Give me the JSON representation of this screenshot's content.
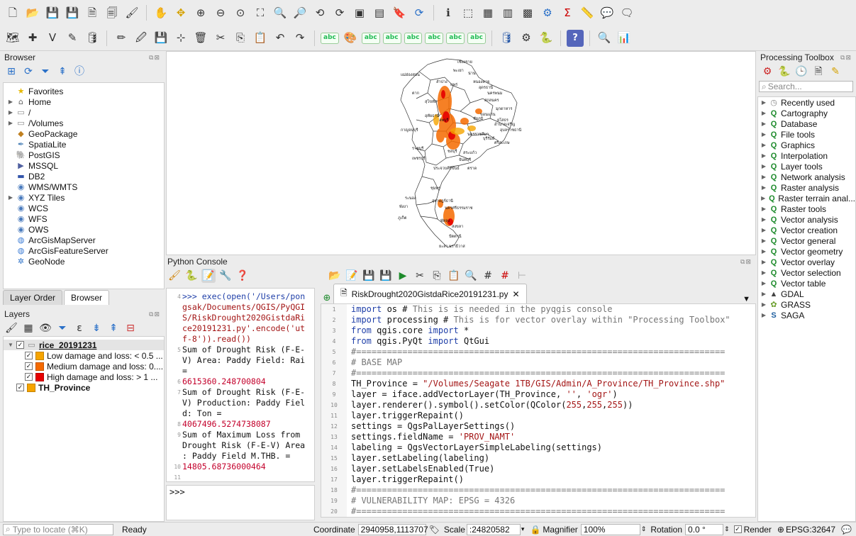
{
  "browser": {
    "title": "Browser",
    "items": [
      {
        "label": "Favorites",
        "icon": "star-icon",
        "caret": false
      },
      {
        "label": "Home",
        "icon": "home-folder-icon",
        "caret": true
      },
      {
        "label": "/",
        "icon": "folder-icon",
        "caret": true
      },
      {
        "label": "/Volumes",
        "icon": "folder-icon",
        "caret": true
      },
      {
        "label": "GeoPackage",
        "icon": "geopackage-icon",
        "caret": false
      },
      {
        "label": "SpatiaLite",
        "icon": "feather-icon",
        "caret": false
      },
      {
        "label": "PostGIS",
        "icon": "elephant-icon",
        "caret": false
      },
      {
        "label": "MSSQL",
        "icon": "mssql-icon",
        "caret": false
      },
      {
        "label": "DB2",
        "icon": "db2-icon",
        "caret": false
      },
      {
        "label": "WMS/WMTS",
        "icon": "globe-icon",
        "caret": false
      },
      {
        "label": "XYZ Tiles",
        "icon": "globe-icon",
        "caret": true
      },
      {
        "label": "WCS",
        "icon": "globe-icon",
        "caret": false
      },
      {
        "label": "WFS",
        "icon": "globe-icon",
        "caret": false
      },
      {
        "label": "OWS",
        "icon": "globe-icon",
        "caret": false
      },
      {
        "label": "ArcGisMapServer",
        "icon": "arcgis-icon",
        "caret": false
      },
      {
        "label": "ArcGisFeatureServer",
        "icon": "arcgis-icon",
        "caret": false
      },
      {
        "label": "GeoNode",
        "icon": "geonode-icon",
        "caret": false
      }
    ]
  },
  "layers_tabs": [
    "Layer Order",
    "Browser"
  ],
  "layers": {
    "title": "Layers",
    "group": "rice_20191231",
    "items": [
      {
        "label": "Low damage and loss: < 0.5 ...",
        "color": "#f6a400"
      },
      {
        "label": "Medium damage and loss: 0....",
        "color": "#f56a00"
      },
      {
        "label": "High damage and loss: > 1 ...",
        "color": "#e60000"
      }
    ],
    "province": {
      "label": "TH_Province",
      "color": "#f6a400"
    }
  },
  "python_console": {
    "title": "Python Console",
    "prompt": ">>>",
    "output": [
      {
        "n": "4",
        "text": ">>> exec(open('/Users/pon",
        "type": "cmd"
      },
      {
        "n": "",
        "text": "gsak/Documents/QGIS/PyQGI",
        "type": "cmd"
      },
      {
        "n": "",
        "text": "S/RiskDrought2020GistdaRi",
        "type": "cmd"
      },
      {
        "n": "",
        "text": "ce20191231.py'.encode('ut",
        "type": "cmd"
      },
      {
        "n": "",
        "text": "f-8')).read())",
        "type": "cmd"
      },
      {
        "n": "5",
        "text": "Sum of Drought Risk (F-E-",
        "type": "text"
      },
      {
        "n": "",
        "text": "V) Area: Paddy Field: Rai",
        "type": "text"
      },
      {
        "n": "",
        "text": " =",
        "type": "text"
      },
      {
        "n": "6",
        "text": "6615360.248700804",
        "type": "num"
      },
      {
        "n": "7",
        "text": "Sum of Drought Risk (F-E-",
        "type": "text"
      },
      {
        "n": "",
        "text": "V) Production: Paddy Fiel",
        "type": "text"
      },
      {
        "n": "",
        "text": "d: Ton =",
        "type": "text"
      },
      {
        "n": "8",
        "text": "4067496.5274738087",
        "type": "num"
      },
      {
        "n": "9",
        "text": "Sum of Maximum Loss from",
        "type": "text"
      },
      {
        "n": "",
        "text": "Drought Risk (F-E-V) Area",
        "type": "text"
      },
      {
        "n": "",
        "text": ": Paddy Field M.THB. =",
        "type": "text"
      },
      {
        "n": "10",
        "text": "14805.68736000464",
        "type": "num"
      },
      {
        "n": "11",
        "text": "",
        "type": "text"
      }
    ]
  },
  "editor": {
    "tab_label": "RiskDrought2020GistdaRice20191231.py",
    "lines": [
      {
        "n": "1",
        "html": "<span class=\"kw\">import</span> os # <span class=\"cm\">This is is needed in the pyqgis console</span>"
      },
      {
        "n": "2",
        "html": "<span class=\"kw\">import</span> processing # <span class=\"cm\">This is for vector overlay within \"Processing Toolbox\"</span>"
      },
      {
        "n": "3",
        "html": "<span class=\"kw\">from</span> qgis.core <span class=\"kw\">import</span> *"
      },
      {
        "n": "4",
        "html": "<span class=\"kw\">from</span> qgis.PyQt <span class=\"kw\">import</span> QtGui"
      },
      {
        "n": "5",
        "html": "<span class=\"cm\">#========================================================================</span>"
      },
      {
        "n": "6",
        "html": "<span class=\"cm\"># BASE MAP</span>"
      },
      {
        "n": "7",
        "html": "<span class=\"cm\">#========================================================================</span>"
      },
      {
        "n": "8",
        "html": "TH_Province = <span class=\"str\">\"/Volumes/Seagate 1TB/GIS/Admin/A_Province/TH_Province.shp\"</span>"
      },
      {
        "n": "9",
        "html": "layer = iface.addVectorLayer(TH_Province, <span class=\"str\">''</span>, <span class=\"str\">'ogr'</span>)"
      },
      {
        "n": "10",
        "html": "layer.renderer().symbol().setColor(QColor(<span class=\"str\">255</span>,<span class=\"str\">255</span>,<span class=\"str\">255</span>))"
      },
      {
        "n": "11",
        "html": "layer.triggerRepaint()"
      },
      {
        "n": "12",
        "html": "settings = QgsPalLayerSettings()"
      },
      {
        "n": "13",
        "html": "settings.fieldName = <span class=\"str\">'PROV_NAMT'</span>"
      },
      {
        "n": "14",
        "html": "labeling = QgsVectorLayerSimpleLabeling(settings)"
      },
      {
        "n": "15",
        "html": "layer.setLabeling(labeling)"
      },
      {
        "n": "16",
        "html": "layer.setLabelsEnabled(True)"
      },
      {
        "n": "17",
        "html": "layer.triggerRepaint()"
      },
      {
        "n": "18",
        "html": "<span class=\"cm\">#========================================================================</span>"
      },
      {
        "n": "19",
        "html": "<span class=\"cm\"># VULNERABILITY MAP: EPSG = 4326</span>"
      },
      {
        "n": "20",
        "html": "<span class=\"cm\">#========================================================================</span>"
      }
    ]
  },
  "map_labels": [
    "เชียงราย",
    "พะเยา",
    "แม่ฮ่องสอน",
    "น่าน",
    "ลำปาง",
    "แพร่",
    "หนองคาย",
    "อุดรธานี",
    "นครพนม",
    "มุกดาหาร",
    "สกลนคร",
    "ตาก",
    "สุโขทัย",
    "ขอนแก่น",
    "ยโสธร",
    "อำนาจเจริญ",
    "อุบลราชธานี",
    "ชัยภูมิ",
    "นครราชสีมา",
    "บุรีรัมย์",
    "ศรีสะเกษ",
    "อุทัยธานี",
    "กาญจนบุรี",
    "ลพบุรี",
    "ราชบุรี",
    "เพชรบุรี",
    "ชลบุรี",
    "จันทบุรี",
    "ตราด",
    "ประจวบคีรีขันธ์",
    "ชุมพร",
    "ระนอง",
    "สุราษฎร์ธานี",
    "พังงา",
    "นครศรีธรรมราช",
    "ภูเก็ต",
    "พัทลุง",
    "สงขลา",
    "ปัตตานี",
    "นราธิวาส",
    "ยะลา",
    "สระแก้ว"
  ],
  "processing": {
    "title": "Processing Toolbox",
    "search_placeholder": "Search...",
    "items": [
      {
        "label": "Recently used",
        "icon": "clock-icon"
      },
      {
        "label": "Cartography",
        "icon": "qgis-icon"
      },
      {
        "label": "Database",
        "icon": "qgis-icon"
      },
      {
        "label": "File tools",
        "icon": "qgis-icon"
      },
      {
        "label": "Graphics",
        "icon": "qgis-icon"
      },
      {
        "label": "Interpolation",
        "icon": "qgis-icon"
      },
      {
        "label": "Layer tools",
        "icon": "qgis-icon"
      },
      {
        "label": "Network analysis",
        "icon": "qgis-icon"
      },
      {
        "label": "Raster analysis",
        "icon": "qgis-icon"
      },
      {
        "label": "Raster terrain anal...",
        "icon": "qgis-icon"
      },
      {
        "label": "Raster tools",
        "icon": "qgis-icon"
      },
      {
        "label": "Vector analysis",
        "icon": "qgis-icon"
      },
      {
        "label": "Vector creation",
        "icon": "qgis-icon"
      },
      {
        "label": "Vector general",
        "icon": "qgis-icon"
      },
      {
        "label": "Vector geometry",
        "icon": "qgis-icon"
      },
      {
        "label": "Vector overlay",
        "icon": "qgis-icon"
      },
      {
        "label": "Vector selection",
        "icon": "qgis-icon"
      },
      {
        "label": "Vector table",
        "icon": "qgis-icon"
      },
      {
        "label": "GDAL",
        "icon": "gdal-icon"
      },
      {
        "label": "GRASS",
        "icon": "grass-icon"
      },
      {
        "label": "SAGA",
        "icon": "saga-icon"
      }
    ]
  },
  "status": {
    "locate_placeholder": "Type to locate (⌘K)",
    "ready": "Ready",
    "coordinate_label": "Coordinate",
    "coordinate_value": "2940958,1113707",
    "scale_label": "Scale",
    "scale_value": ":24820582",
    "magnifier_label": "Magnifier",
    "magnifier_value": "100%",
    "rotation_label": "Rotation",
    "rotation_value": "0.0 °",
    "render_label": "Render",
    "epsg": "EPSG:32647"
  },
  "toolbar_labels": {
    "abc": "abc"
  }
}
